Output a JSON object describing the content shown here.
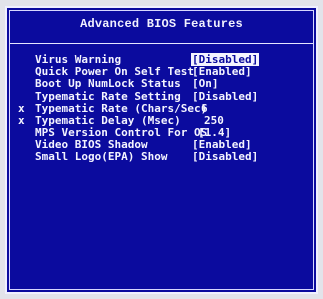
{
  "panel": {
    "title": "Advanced BIOS Features"
  },
  "items": [
    {
      "marker": "",
      "label": "Virus Warning",
      "value": "[Disabled]",
      "selected": true
    },
    {
      "marker": "",
      "label": "Quick Power On Self Test",
      "value": "[Enabled]",
      "selected": false
    },
    {
      "marker": "",
      "label": "Boot Up NumLock Status",
      "value": "[On]",
      "selected": false
    },
    {
      "marker": "",
      "label": "Typematic Rate Setting",
      "value": "[Disabled]",
      "selected": false
    },
    {
      "marker": "x",
      "label": "Typematic Rate (Chars/Sec)",
      "value": "6",
      "selected": false
    },
    {
      "marker": "x",
      "label": "Typematic Delay (Msec)",
      "value": "250",
      "selected": false
    },
    {
      "marker": "",
      "label": "MPS Version Control For OS",
      "value": "[1.4]",
      "selected": false
    },
    {
      "marker": "",
      "label": "Video BIOS Shadow",
      "value": "[Enabled]",
      "selected": false
    },
    {
      "marker": "",
      "label": "Small Logo(EPA) Show",
      "value": "[Disabled]",
      "selected": false
    }
  ],
  "colors": {
    "background": "#0b0b9e",
    "text": "#f4f4ff"
  }
}
